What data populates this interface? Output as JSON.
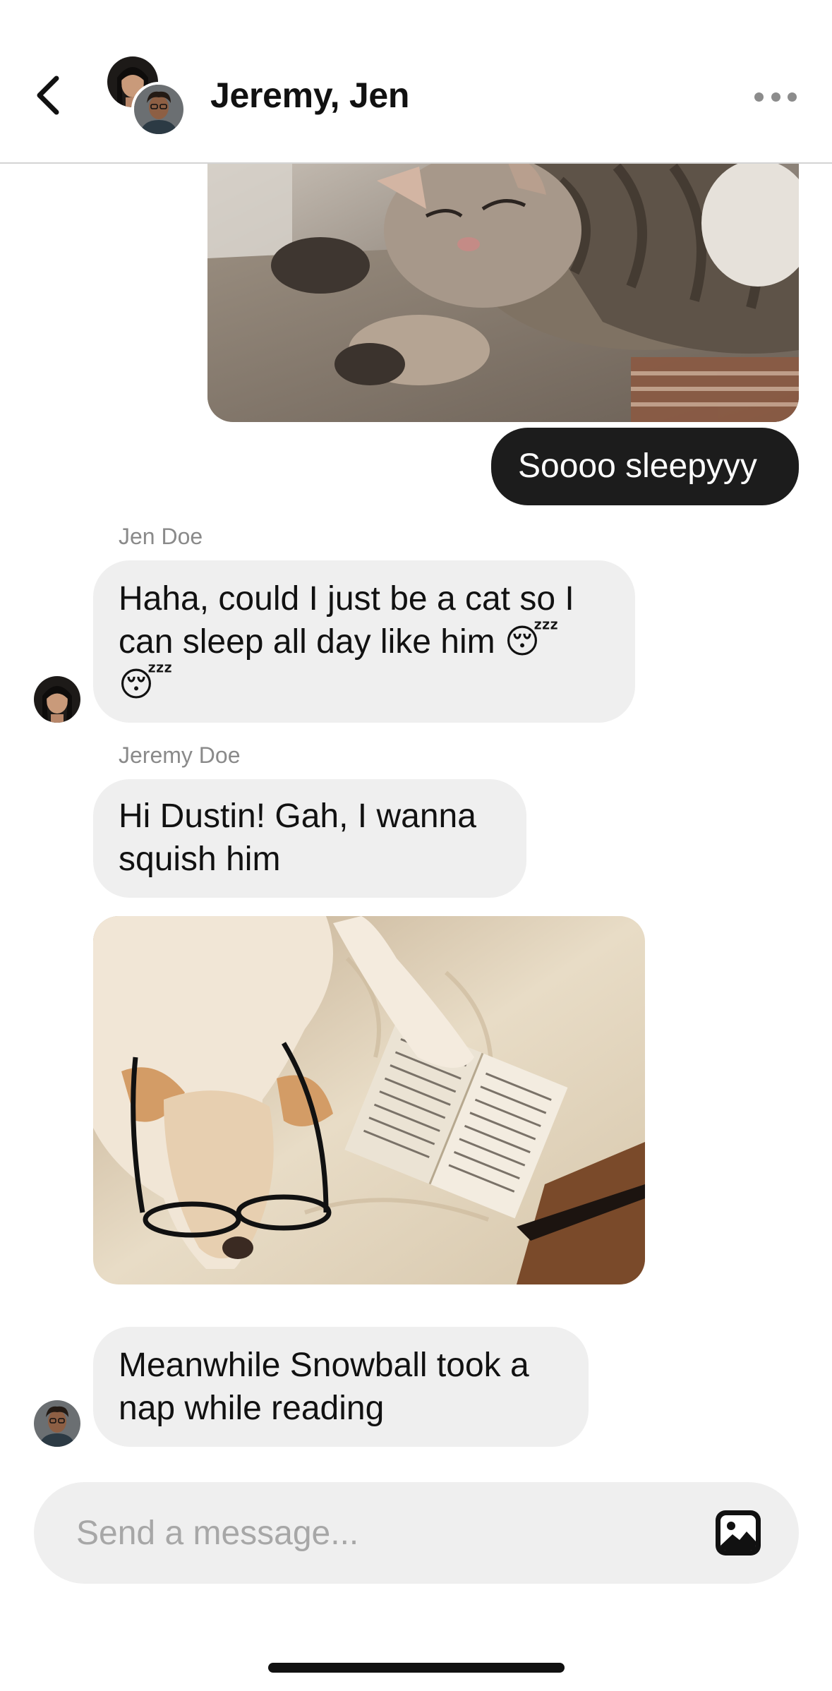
{
  "header": {
    "title": "Jeremy, Jen"
  },
  "messages": {
    "outgoing_1": "Soooo sleepyyy",
    "jen_sender": "Jen Doe",
    "jen_text_line1": "Haha, could I just be a cat so I",
    "jen_text_line2": "can sleep all day like him 😴",
    "jen_text_line3": "😴",
    "jeremy_sender": "Jeremy Doe",
    "jeremy_text_1_line1": "Hi Dustin! Gah, I wanna",
    "jeremy_text_1_line2": "squish him",
    "jeremy_text_2_line1": "Meanwhile Snowball took a",
    "jeremy_text_2_line2": "nap while reading"
  },
  "composer": {
    "placeholder": "Send a message..."
  },
  "colors": {
    "outgoing_bubble": "#1c1c1c",
    "incoming_bubble": "#efefef",
    "sender_label": "#8a8a8a"
  },
  "icons": [
    "chevron-left-icon",
    "more-icon",
    "image-icon"
  ]
}
